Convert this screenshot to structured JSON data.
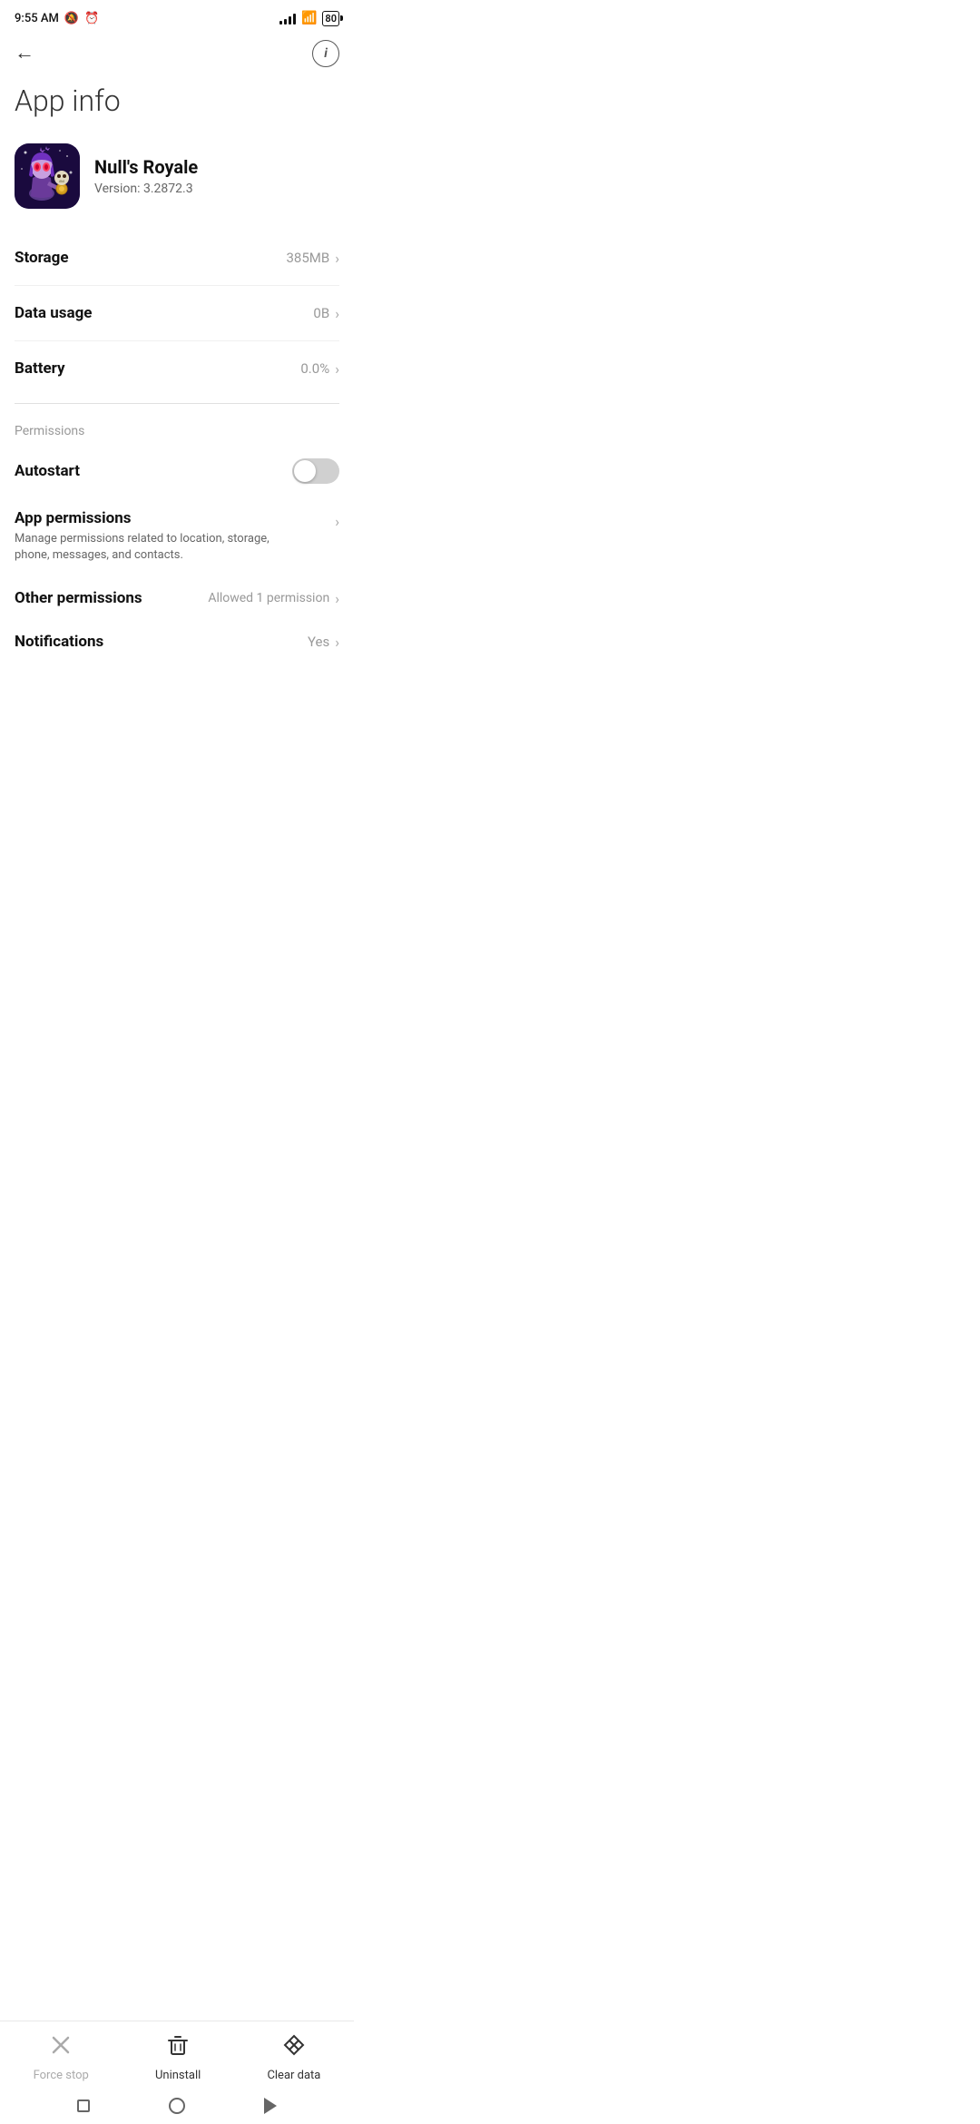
{
  "status_bar": {
    "time": "9:55 AM",
    "battery": "80"
  },
  "nav": {
    "back_label": "←",
    "info_label": "i"
  },
  "page": {
    "title": "App info"
  },
  "app": {
    "name": "Null's Royale",
    "version": "Version: 3.2872.3"
  },
  "rows": {
    "storage_label": "Storage",
    "storage_value": "385MB",
    "data_usage_label": "Data usage",
    "data_usage_value": "0B",
    "battery_label": "Battery",
    "battery_value": "0.0%"
  },
  "permissions": {
    "section_label": "Permissions",
    "autostart_label": "Autostart",
    "app_permissions_title": "App permissions",
    "app_permissions_desc": "Manage permissions related to location, storage, phone, messages, and contacts.",
    "other_permissions_label": "Other permissions",
    "other_permissions_value": "Allowed 1 permission",
    "notifications_label": "Notifications",
    "notifications_value": "Yes"
  },
  "bottom_actions": {
    "force_stop_label": "Force stop",
    "uninstall_label": "Uninstall",
    "clear_data_label": "Clear data"
  },
  "nav_bar": {
    "square": "□",
    "circle": "○",
    "triangle": "◁"
  }
}
